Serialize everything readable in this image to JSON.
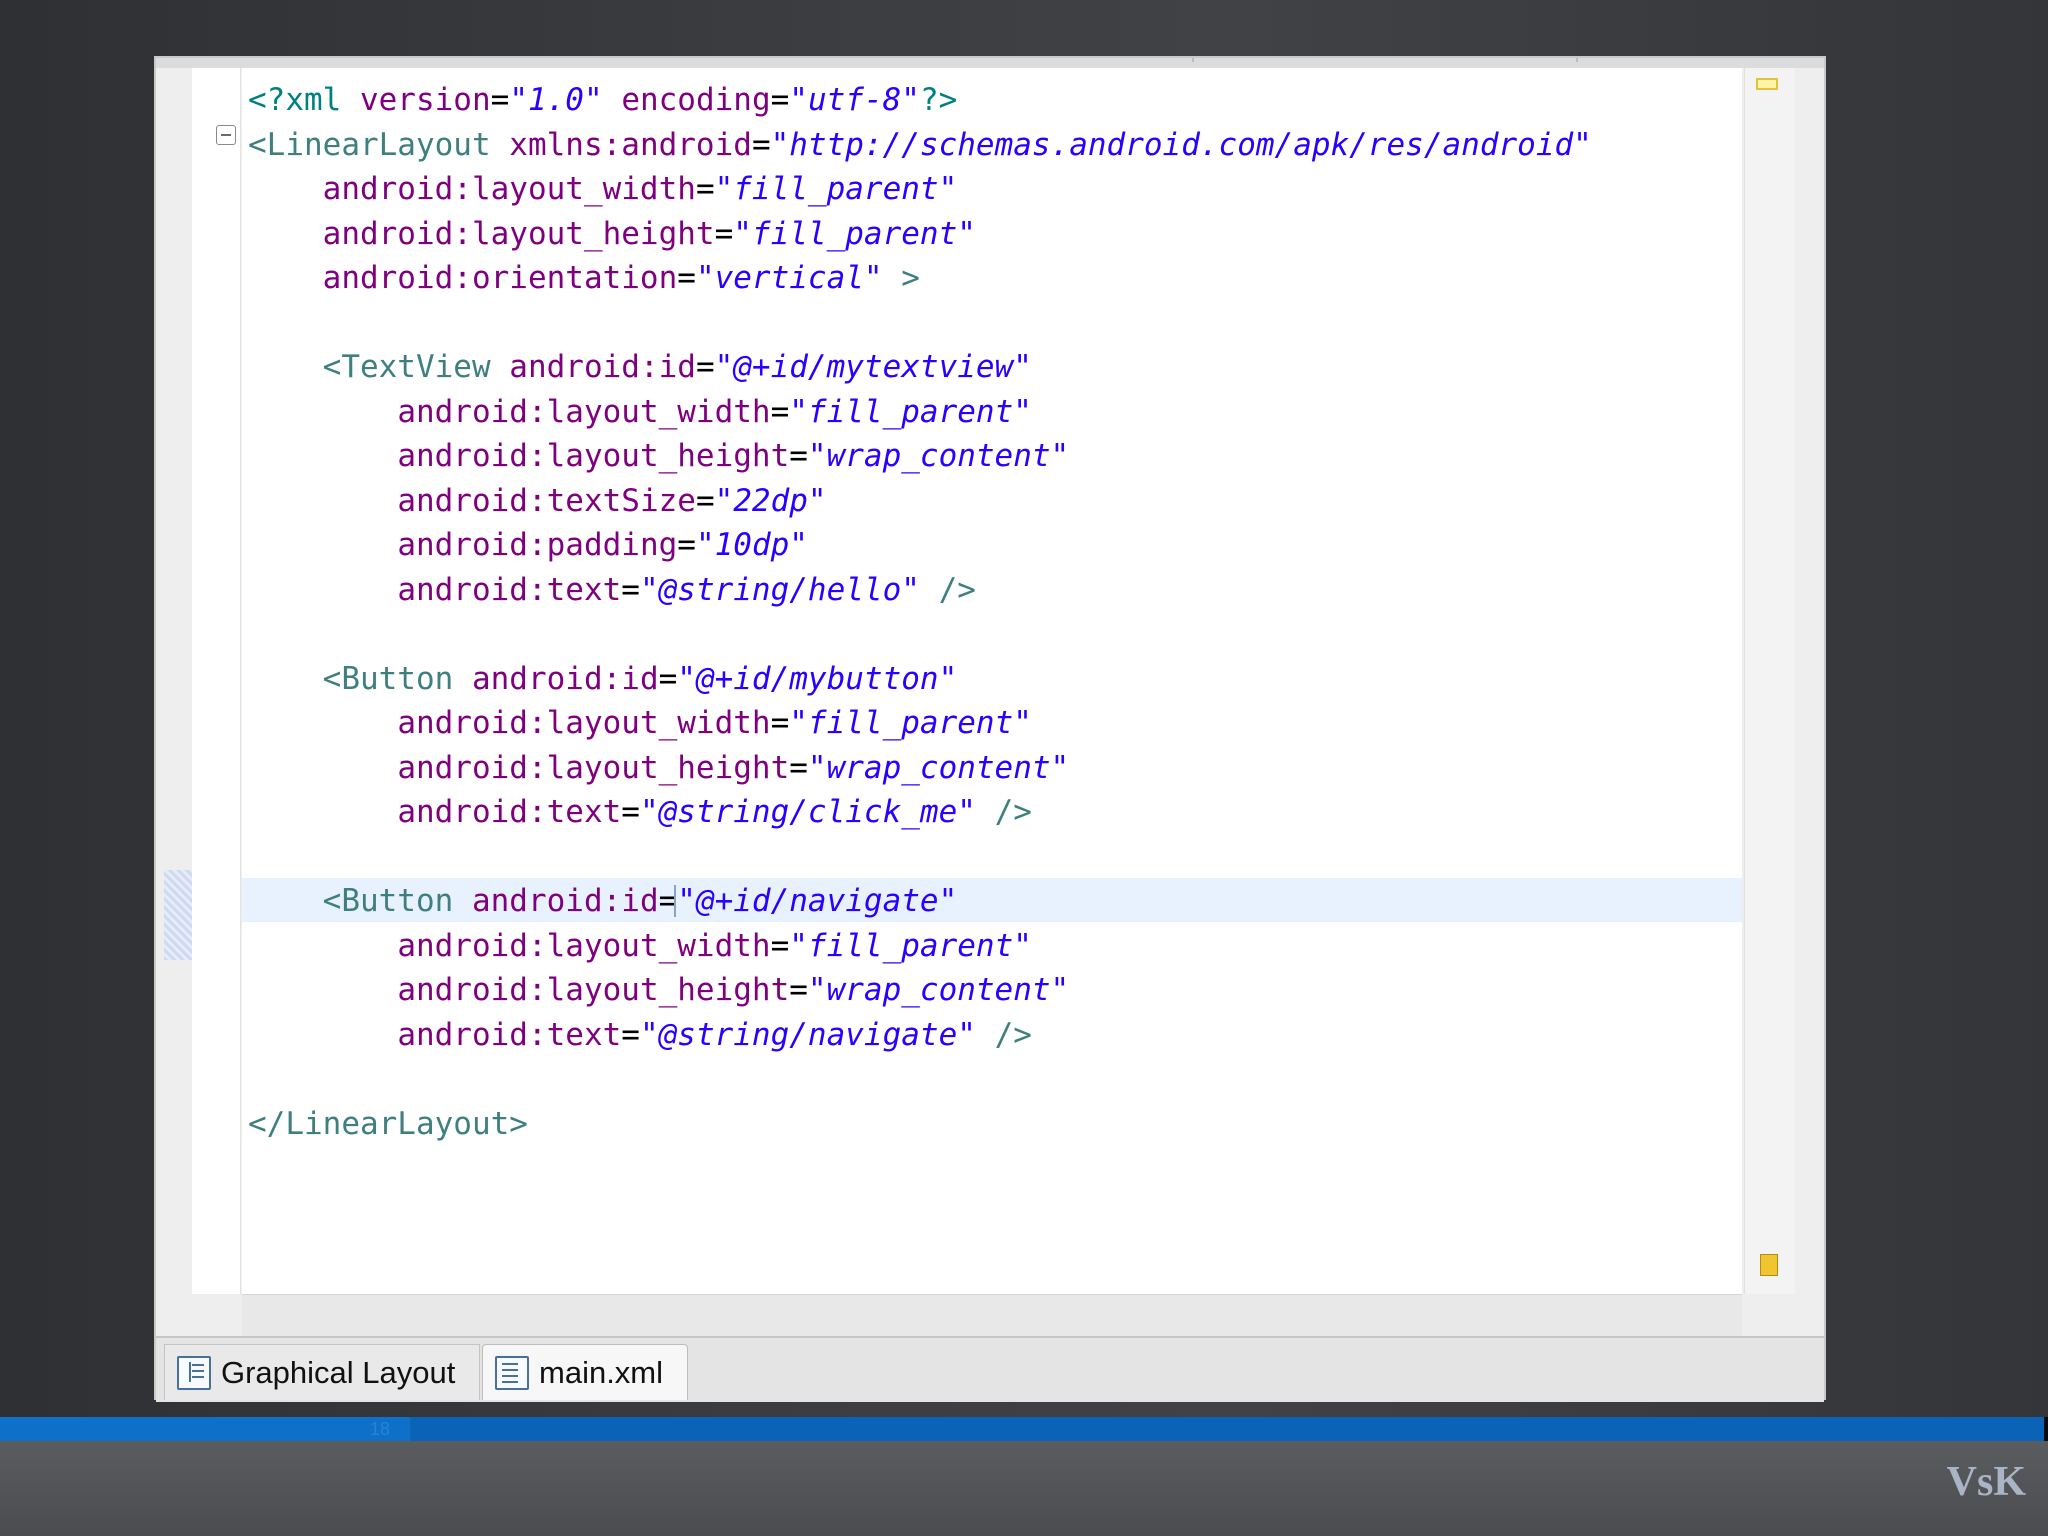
{
  "editor": {
    "code_lines": [
      [
        {
          "t": "pi",
          "v": "<?xml "
        },
        {
          "t": "attr",
          "v": "version"
        },
        {
          "t": "eq",
          "v": "="
        },
        {
          "t": "val",
          "v": "\"1.0\""
        },
        {
          "t": "pi",
          "v": " "
        },
        {
          "t": "attr",
          "v": "encoding"
        },
        {
          "t": "eq",
          "v": "="
        },
        {
          "t": "val",
          "v": "\"utf-8\""
        },
        {
          "t": "pi",
          "v": "?>"
        }
      ],
      [
        {
          "t": "tag",
          "v": "<LinearLayout "
        },
        {
          "t": "attr",
          "v": "xmlns:android"
        },
        {
          "t": "eq",
          "v": "="
        },
        {
          "t": "val",
          "v": "\"http://schemas.android.com/apk/res/android\""
        }
      ],
      [
        {
          "t": "pi",
          "v": "    "
        },
        {
          "t": "attr",
          "v": "android:layout_width"
        },
        {
          "t": "eq",
          "v": "="
        },
        {
          "t": "val",
          "v": "\"fill_parent\""
        }
      ],
      [
        {
          "t": "pi",
          "v": "    "
        },
        {
          "t": "attr",
          "v": "android:layout_height"
        },
        {
          "t": "eq",
          "v": "="
        },
        {
          "t": "val",
          "v": "\"fill_parent\""
        }
      ],
      [
        {
          "t": "pi",
          "v": "    "
        },
        {
          "t": "attr",
          "v": "android:orientation"
        },
        {
          "t": "eq",
          "v": "="
        },
        {
          "t": "val",
          "v": "\"vertical\""
        },
        {
          "t": "tag",
          "v": " >"
        }
      ],
      [],
      [
        {
          "t": "pi",
          "v": "    "
        },
        {
          "t": "tag",
          "v": "<TextView "
        },
        {
          "t": "attr",
          "v": "android:id"
        },
        {
          "t": "eq",
          "v": "="
        },
        {
          "t": "val",
          "v": "\"@+id/mytextview\""
        }
      ],
      [
        {
          "t": "pi",
          "v": "        "
        },
        {
          "t": "attr",
          "v": "android:layout_width"
        },
        {
          "t": "eq",
          "v": "="
        },
        {
          "t": "val",
          "v": "\"fill_parent\""
        }
      ],
      [
        {
          "t": "pi",
          "v": "        "
        },
        {
          "t": "attr",
          "v": "android:layout_height"
        },
        {
          "t": "eq",
          "v": "="
        },
        {
          "t": "val",
          "v": "\"wrap_content\""
        }
      ],
      [
        {
          "t": "pi",
          "v": "        "
        },
        {
          "t": "attr",
          "v": "android:textSize"
        },
        {
          "t": "eq",
          "v": "="
        },
        {
          "t": "val",
          "v": "\"22dp\""
        }
      ],
      [
        {
          "t": "pi",
          "v": "        "
        },
        {
          "t": "attr",
          "v": "android:padding"
        },
        {
          "t": "eq",
          "v": "="
        },
        {
          "t": "val",
          "v": "\"10dp\""
        }
      ],
      [
        {
          "t": "pi",
          "v": "        "
        },
        {
          "t": "attr",
          "v": "android:text"
        },
        {
          "t": "eq",
          "v": "="
        },
        {
          "t": "val",
          "v": "\"@string/hello\""
        },
        {
          "t": "tag",
          "v": " />"
        }
      ],
      [],
      [
        {
          "t": "pi",
          "v": "    "
        },
        {
          "t": "tag",
          "v": "<Button "
        },
        {
          "t": "attr",
          "v": "android:id"
        },
        {
          "t": "eq",
          "v": "="
        },
        {
          "t": "val",
          "v": "\"@+id/mybutton\""
        }
      ],
      [
        {
          "t": "pi",
          "v": "        "
        },
        {
          "t": "attr",
          "v": "android:layout_width"
        },
        {
          "t": "eq",
          "v": "="
        },
        {
          "t": "val",
          "v": "\"fill_parent\""
        }
      ],
      [
        {
          "t": "pi",
          "v": "        "
        },
        {
          "t": "attr",
          "v": "android:layout_height"
        },
        {
          "t": "eq",
          "v": "="
        },
        {
          "t": "val",
          "v": "\"wrap_content\""
        }
      ],
      [
        {
          "t": "pi",
          "v": "        "
        },
        {
          "t": "attr",
          "v": "android:text"
        },
        {
          "t": "eq",
          "v": "="
        },
        {
          "t": "val",
          "v": "\"@string/click_me\""
        },
        {
          "t": "tag",
          "v": " />"
        }
      ],
      [],
      [
        {
          "t": "pi",
          "v": "    "
        },
        {
          "t": "tag",
          "v": "<Button "
        },
        {
          "t": "attr",
          "v": "android:id"
        },
        {
          "t": "eq",
          "v": "="
        },
        {
          "t": "cursor",
          "v": ""
        },
        {
          "t": "val",
          "v": "\"@+id/navigate\""
        }
      ],
      [
        {
          "t": "pi",
          "v": "        "
        },
        {
          "t": "attr",
          "v": "android:layout_width"
        },
        {
          "t": "eq",
          "v": "="
        },
        {
          "t": "val",
          "v": "\"fill_parent\""
        }
      ],
      [
        {
          "t": "pi",
          "v": "        "
        },
        {
          "t": "attr",
          "v": "android:layout_height"
        },
        {
          "t": "eq",
          "v": "="
        },
        {
          "t": "val",
          "v": "\"wrap_content\""
        }
      ],
      [
        {
          "t": "pi",
          "v": "        "
        },
        {
          "t": "attr",
          "v": "android:text"
        },
        {
          "t": "eq",
          "v": "="
        },
        {
          "t": "val",
          "v": "\"@string/navigate\""
        },
        {
          "t": "tag",
          "v": " />"
        }
      ],
      [],
      [
        {
          "t": "tag",
          "v": "</LinearLayout>"
        }
      ]
    ],
    "current_line": 19
  },
  "tabs": {
    "graphical_label": "Graphical Layout",
    "xml_label": "main.xml",
    "active": "xml"
  },
  "slide": {
    "page_number": "18",
    "brand": "VsK",
    "progress": 0.2
  },
  "colors": {
    "tag": "#3f7f7f",
    "attribute": "#7f007f",
    "value": "#2a00ff",
    "progress_bar": "#0b63b8"
  },
  "icons": {
    "fold": "fold-collapse-icon",
    "graphical_tab": "layout-icon",
    "xml_tab": "xml-file-icon",
    "ruler_warning": "warning-marker-icon"
  }
}
